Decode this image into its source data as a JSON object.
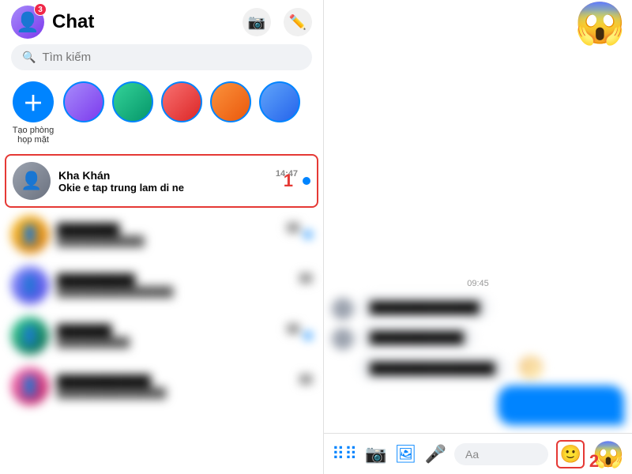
{
  "header": {
    "title": "Chat",
    "badge_count": "3",
    "camera_icon": "📷",
    "edit_icon": "✏️"
  },
  "search": {
    "placeholder": "Tìm kiếm"
  },
  "stories": [
    {
      "type": "new",
      "label": "Tạo phòng họp mặt",
      "color": "new"
    },
    {
      "label": "",
      "color": "g1"
    },
    {
      "label": "",
      "color": "g2"
    },
    {
      "label": "",
      "color": "g3"
    },
    {
      "label": "",
      "color": "g4"
    },
    {
      "label": "",
      "color": "g5"
    }
  ],
  "conversations": [
    {
      "id": 1,
      "name": "Kha Khán",
      "preview": "Okie e tap trung lam di ne",
      "time": "14:47",
      "unread": true,
      "highlighted": true,
      "step": "1",
      "avatar_class": "ca1"
    },
    {
      "id": 2,
      "name": "",
      "preview": "",
      "time": "",
      "unread": true,
      "highlighted": false,
      "avatar_class": "ca2"
    },
    {
      "id": 3,
      "name": "",
      "preview": "",
      "time": "",
      "unread": false,
      "highlighted": false,
      "avatar_class": "ca3"
    },
    {
      "id": 4,
      "name": "",
      "preview": "",
      "time": "",
      "unread": true,
      "highlighted": false,
      "avatar_class": "ca4"
    },
    {
      "id": 5,
      "name": "",
      "preview": "",
      "time": "",
      "unread": false,
      "highlighted": false,
      "avatar_class": "ca5"
    }
  ],
  "chat": {
    "time_label": "09:45",
    "emoji_top": "😱",
    "input_placeholder": "Aa",
    "step2_label": "2",
    "right_emoji": "😱"
  },
  "toolbar": {
    "dots_icon": "⁞⁞",
    "camera_icon": "📷",
    "image_icon": "🖼",
    "mic_icon": "🎤",
    "emoji_icon": "🙂"
  }
}
